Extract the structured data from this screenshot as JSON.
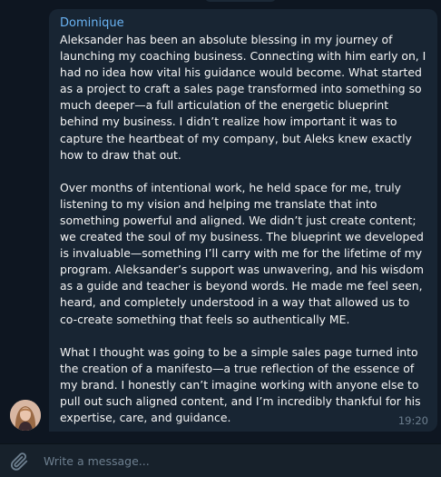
{
  "message": {
    "sender": "Dominique",
    "paragraphs": [
      "Aleksander has been an absolute blessing in my journey of launching my coaching business. Connecting with him early on, I had no idea how vital his guidance would become. What started as a project to craft a sales page transformed into something so much deeper—a full articulation of the energetic blueprint behind my business. I didn’t realize how important it was to capture the heartbeat of my company, but Aleks knew exactly how to draw that out.",
      "Over months of intentional work, he held space for me, truly listening to my vision and helping me translate that into something powerful and aligned. We didn’t just create content; we created the soul of my business. The blueprint we developed is invaluable—something I’ll carry with me for the lifetime of my program. Aleksander’s support was unwavering, and his wisdom as a guide and teacher is beyond words. He made me feel seen, heard, and completely understood in a way that allowed us to co-create something that feels so authentically ME.",
      "What I thought was going to be a simple sales page turned into the creation of a manifesto—a true reflection of the essence of my brand. I honestly can’t imagine working with anyone else to pull out such aligned content, and I’m incredibly thankful for his expertise, care, and guidance."
    ],
    "time": "19:20"
  },
  "composer": {
    "placeholder": "Write a message..."
  },
  "icons": {
    "attach": "paperclip-icon",
    "avatar": "user-avatar"
  },
  "colors": {
    "chat_background": "#0e1621",
    "bubble": "#182533",
    "sender_name": "#6ab3f3",
    "text": "#f5f5f5",
    "muted": "#6d7f8f",
    "composer": "#17212b"
  }
}
